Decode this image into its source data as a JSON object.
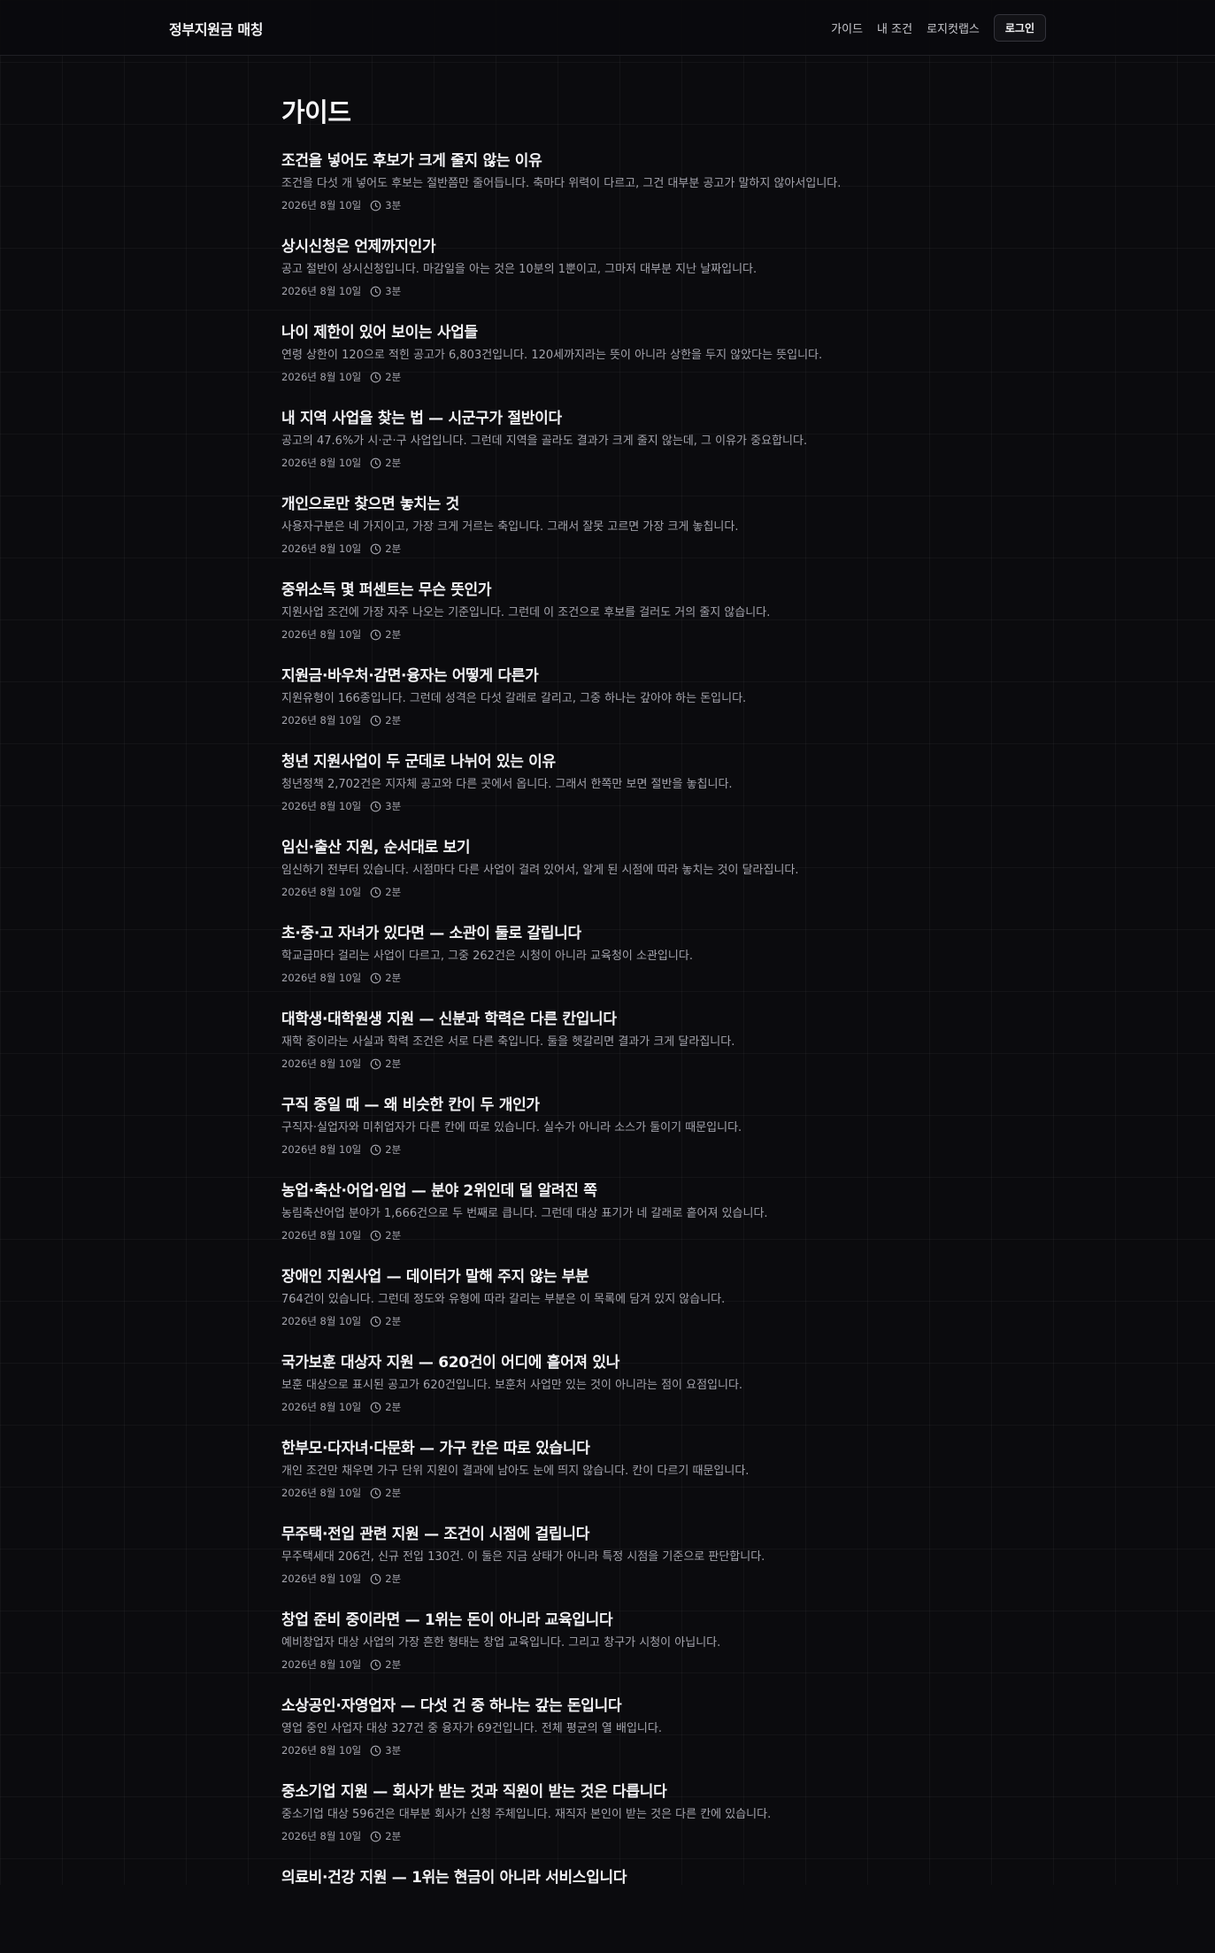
{
  "header": {
    "brand": "정부지원금 매칭",
    "nav": [
      "가이드",
      "내 조건",
      "로지컷랩스"
    ],
    "login": "로그인"
  },
  "page": {
    "title": "가이드"
  },
  "articles": [
    {
      "title": "조건을 넣어도 후보가 크게 줄지 않는 이유",
      "summary": "조건을 다섯 개 넣어도 후보는 절반쯤만 줄어듭니다. 축마다 위력이 다르고, 그건 대부분 공고가 말하지 않아서입니다.",
      "date": "2026년 8월 10일",
      "read": "3분"
    },
    {
      "title": "상시신청은 언제까지인가",
      "summary": "공고 절반이 상시신청입니다. 마감일을 아는 것은 10분의 1뿐이고, 그마저 대부분 지난 날짜입니다.",
      "date": "2026년 8월 10일",
      "read": "3분"
    },
    {
      "title": "나이 제한이 있어 보이는 사업들",
      "summary": "연령 상한이 120으로 적힌 공고가 6,803건입니다. 120세까지라는 뜻이 아니라 상한을 두지 않았다는 뜻입니다.",
      "date": "2026년 8월 10일",
      "read": "2분"
    },
    {
      "title": "내 지역 사업을 찾는 법 — 시군구가 절반이다",
      "summary": "공고의 47.6%가 시·군·구 사업입니다. 그런데 지역을 골라도 결과가 크게 줄지 않는데, 그 이유가 중요합니다.",
      "date": "2026년 8월 10일",
      "read": "2분"
    },
    {
      "title": "개인으로만 찾으면 놓치는 것",
      "summary": "사용자구분은 네 가지이고, 가장 크게 거르는 축입니다. 그래서 잘못 고르면 가장 크게 놓칩니다.",
      "date": "2026년 8월 10일",
      "read": "2분"
    },
    {
      "title": "중위소득 몇 퍼센트는 무슨 뜻인가",
      "summary": "지원사업 조건에 가장 자주 나오는 기준입니다. 그런데 이 조건으로 후보를 걸러도 거의 줄지 않습니다.",
      "date": "2026년 8월 10일",
      "read": "2분"
    },
    {
      "title": "지원금·바우처·감면·융자는 어떻게 다른가",
      "summary": "지원유형이 166종입니다. 그런데 성격은 다섯 갈래로 갈리고, 그중 하나는 갚아야 하는 돈입니다.",
      "date": "2026년 8월 10일",
      "read": "2분"
    },
    {
      "title": "청년 지원사업이 두 군데로 나뉘어 있는 이유",
      "summary": "청년정책 2,702건은 지자체 공고와 다른 곳에서 옵니다. 그래서 한쪽만 보면 절반을 놓칩니다.",
      "date": "2026년 8월 10일",
      "read": "3분"
    },
    {
      "title": "임신·출산 지원, 순서대로 보기",
      "summary": "임신하기 전부터 있습니다. 시점마다 다른 사업이 걸려 있어서, 알게 된 시점에 따라 놓치는 것이 달라집니다.",
      "date": "2026년 8월 10일",
      "read": "2분"
    },
    {
      "title": "초·중·고 자녀가 있다면 — 소관이 둘로 갈립니다",
      "summary": "학교급마다 걸리는 사업이 다르고, 그중 262건은 시청이 아니라 교육청이 소관입니다.",
      "date": "2026년 8월 10일",
      "read": "2분"
    },
    {
      "title": "대학생·대학원생 지원 — 신분과 학력은 다른 칸입니다",
      "summary": "재학 중이라는 사실과 학력 조건은 서로 다른 축입니다. 둘을 헷갈리면 결과가 크게 달라집니다.",
      "date": "2026년 8월 10일",
      "read": "2분"
    },
    {
      "title": "구직 중일 때 — 왜 비슷한 칸이 두 개인가",
      "summary": "구직자·실업자와 미취업자가 다른 칸에 따로 있습니다. 실수가 아니라 소스가 둘이기 때문입니다.",
      "date": "2026년 8월 10일",
      "read": "2분"
    },
    {
      "title": "농업·축산·어업·임업 — 분야 2위인데 덜 알려진 쪽",
      "summary": "농림축산어업 분야가 1,666건으로 두 번째로 큽니다. 그런데 대상 표기가 네 갈래로 흩어져 있습니다.",
      "date": "2026년 8월 10일",
      "read": "2분"
    },
    {
      "title": "장애인 지원사업 — 데이터가 말해 주지 않는 부분",
      "summary": "764건이 있습니다. 그런데 정도와 유형에 따라 갈리는 부분은 이 목록에 담겨 있지 않습니다.",
      "date": "2026년 8월 10일",
      "read": "2분"
    },
    {
      "title": "국가보훈 대상자 지원 — 620건이 어디에 흩어져 있나",
      "summary": "보훈 대상으로 표시된 공고가 620건입니다. 보훈처 사업만 있는 것이 아니라는 점이 요점입니다.",
      "date": "2026년 8월 10일",
      "read": "2분"
    },
    {
      "title": "한부모·다자녀·다문화 — 가구 칸은 따로 있습니다",
      "summary": "개인 조건만 채우면 가구 단위 지원이 결과에 남아도 눈에 띄지 않습니다. 칸이 다르기 때문입니다.",
      "date": "2026년 8월 10일",
      "read": "2분"
    },
    {
      "title": "무주택·전입 관련 지원 — 조건이 시점에 걸립니다",
      "summary": "무주택세대 206건, 신규 전입 130건. 이 둘은 지금 상태가 아니라 특정 시점을 기준으로 판단합니다.",
      "date": "2026년 8월 10일",
      "read": "2분"
    },
    {
      "title": "창업 준비 중이라면 — 1위는 돈이 아니라 교육입니다",
      "summary": "예비창업자 대상 사업의 가장 흔한 형태는 창업 교육입니다. 그리고 창구가 시청이 아닙니다.",
      "date": "2026년 8월 10일",
      "read": "2분"
    },
    {
      "title": "소상공인·자영업자 — 다섯 건 중 하나는 갚는 돈입니다",
      "summary": "영업 중인 사업자 대상 327건 중 융자가 69건입니다. 전체 평균의 열 배입니다.",
      "date": "2026년 8월 10일",
      "read": "3분"
    },
    {
      "title": "중소기업 지원 — 회사가 받는 것과 직원이 받는 것은 다릅니다",
      "summary": "중소기업 대상 596건은 대부분 회사가 신청 주체입니다. 재직자 본인이 받는 것은 다른 칸에 있습니다.",
      "date": "2026년 8월 10일",
      "read": "2분"
    },
    {
      "title": "의료비·건강 지원 — 1위는 현금이 아니라 서비스입니다",
      "summary": "",
      "date": "",
      "read": ""
    }
  ]
}
